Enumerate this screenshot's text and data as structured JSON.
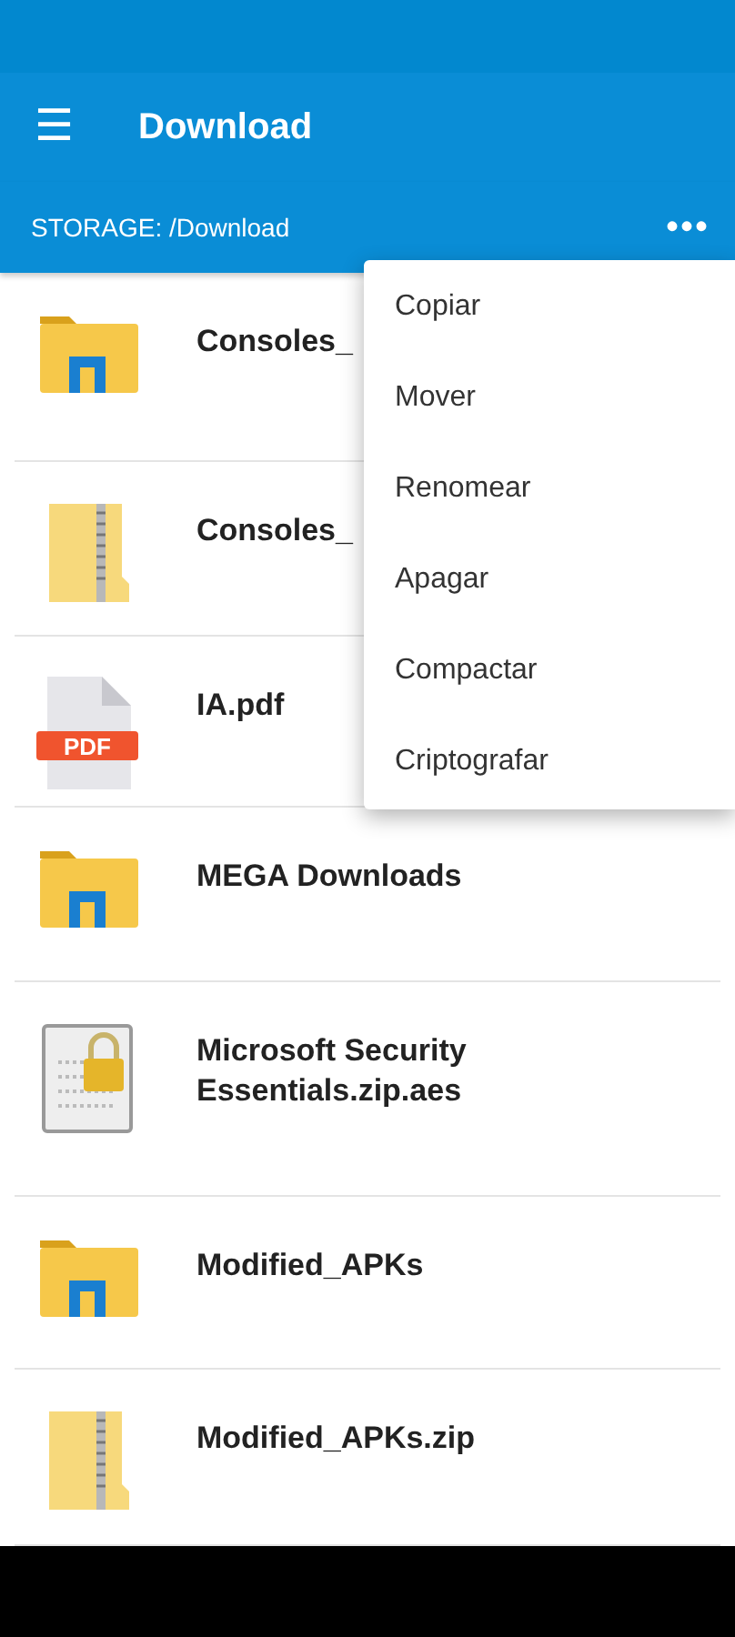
{
  "toolbar": {
    "menu_icon": "☰",
    "title": "Download"
  },
  "path_bar": {
    "label": "STORAGE: /Download",
    "more": "•••"
  },
  "files": [
    {
      "kind": "folder",
      "name": "Consoles_"
    },
    {
      "kind": "zip",
      "name": "Consoles_"
    },
    {
      "kind": "pdf",
      "name": "IA.pdf",
      "badge": "PDF"
    },
    {
      "kind": "folder",
      "name": "MEGA Downloads"
    },
    {
      "kind": "encrypted",
      "name": "Microsoft Security Essentials.zip.aes"
    },
    {
      "kind": "folder",
      "name": "Modified_APKs"
    },
    {
      "kind": "zip",
      "name": "Modified_APKs.zip"
    }
  ],
  "context_menu": [
    "Copiar",
    "Mover",
    "Renomear",
    "Apagar",
    "Compactar",
    "Criptografar"
  ]
}
